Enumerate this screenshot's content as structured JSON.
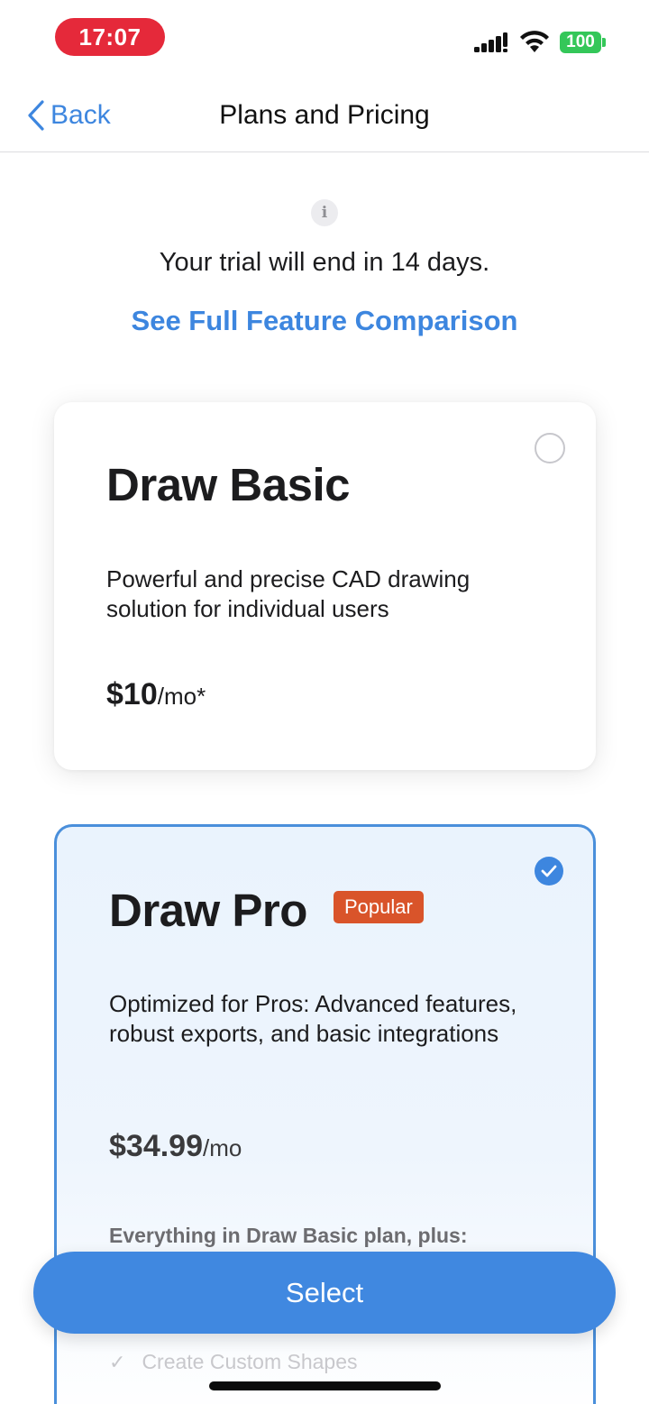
{
  "status_bar": {
    "time": "17:07",
    "battery": "100",
    "time_pill_color": "#e5293a",
    "battery_color": "#34c759"
  },
  "nav": {
    "back_label": "Back",
    "title": "Plans and Pricing"
  },
  "info": {
    "icon_glyph": "i",
    "trial_text": "Your trial will end in 14 days.",
    "compare_link": "See Full Feature Comparison"
  },
  "plans": [
    {
      "name": "Draw Basic",
      "description": "Powerful and precise CAD drawing solution for individual users",
      "price": "$10",
      "price_unit": "/mo*",
      "selected": false
    },
    {
      "name": "Draw Pro",
      "badge": "Popular",
      "description": "Optimized for Pros: Advanced features, robust exports, and basic integrations",
      "price": "$34.99",
      "price_unit": "/mo",
      "includes_text": "Everything in Draw Basic plan, plus:",
      "features": [
        "Create Custom Shapes"
      ],
      "selected": true
    }
  ],
  "select_button": {
    "label": "Select"
  },
  "colors": {
    "accent": "#3d86df",
    "badge": "#d9542a",
    "selected_border": "#4a8fdb"
  }
}
